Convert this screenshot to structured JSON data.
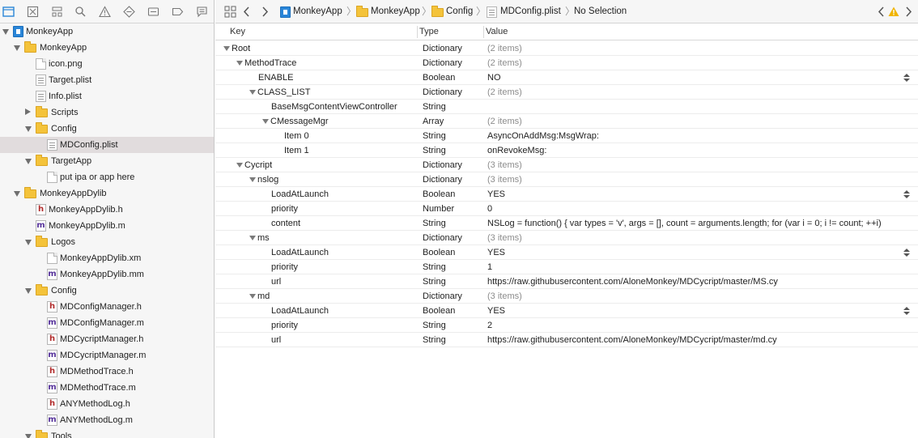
{
  "nav_toolbar": {
    "icons": [
      "project-navigator-icon",
      "source-control-icon",
      "symbol-navigator-icon",
      "find-icon",
      "issue-icon",
      "test-icon",
      "debug-icon",
      "breakpoint-icon",
      "report-icon"
    ]
  },
  "nav_tree": [
    {
      "label": "MonkeyApp",
      "kind": "project",
      "depth": 0,
      "state": "open"
    },
    {
      "label": "MonkeyApp",
      "kind": "folder",
      "depth": 1,
      "state": "open"
    },
    {
      "label": "icon.png",
      "kind": "file",
      "depth": 2
    },
    {
      "label": "Target.plist",
      "kind": "plist",
      "depth": 2
    },
    {
      "label": "Info.plist",
      "kind": "plist",
      "depth": 2
    },
    {
      "label": "Scripts",
      "kind": "folder",
      "depth": 2,
      "state": "closed"
    },
    {
      "label": "Config",
      "kind": "folder",
      "depth": 2,
      "state": "open"
    },
    {
      "label": "MDConfig.plist",
      "kind": "plist",
      "depth": 3,
      "selected": true
    },
    {
      "label": "TargetApp",
      "kind": "folder",
      "depth": 2,
      "state": "open"
    },
    {
      "label": "put ipa or app here",
      "kind": "file",
      "depth": 3
    },
    {
      "label": "MonkeyAppDylib",
      "kind": "folder",
      "depth": 1,
      "state": "open"
    },
    {
      "label": "MonkeyAppDylib.h",
      "kind": "h",
      "depth": 2
    },
    {
      "label": "MonkeyAppDylib.m",
      "kind": "m",
      "depth": 2
    },
    {
      "label": "Logos",
      "kind": "folder",
      "depth": 2,
      "state": "open"
    },
    {
      "label": "MonkeyAppDylib.xm",
      "kind": "file",
      "depth": 3
    },
    {
      "label": "MonkeyAppDylib.mm",
      "kind": "m",
      "depth": 3
    },
    {
      "label": "Config",
      "kind": "folder",
      "depth": 2,
      "state": "open"
    },
    {
      "label": "MDConfigManager.h",
      "kind": "h",
      "depth": 3
    },
    {
      "label": "MDConfigManager.m",
      "kind": "m",
      "depth": 3
    },
    {
      "label": "MDCycriptManager.h",
      "kind": "h",
      "depth": 3
    },
    {
      "label": "MDCycriptManager.m",
      "kind": "m",
      "depth": 3
    },
    {
      "label": "MDMethodTrace.h",
      "kind": "h",
      "depth": 3
    },
    {
      "label": "MDMethodTrace.m",
      "kind": "m",
      "depth": 3
    },
    {
      "label": "ANYMethodLog.h",
      "kind": "h",
      "depth": 3
    },
    {
      "label": "ANYMethodLog.m",
      "kind": "m",
      "depth": 3
    },
    {
      "label": "Tools",
      "kind": "folder",
      "depth": 2,
      "state": "open"
    }
  ],
  "jumpbar": {
    "crumbs": [
      "MonkeyApp",
      "MonkeyApp",
      "Config",
      "MDConfig.plist",
      "No Selection"
    ]
  },
  "plist": {
    "columns": {
      "key": "Key",
      "type": "Type",
      "value": "Value"
    },
    "rows": [
      {
        "key": "Root",
        "type": "Dictionary",
        "value": "(2 items)",
        "depth": 0,
        "disclosure": true,
        "gray": true
      },
      {
        "key": "MethodTrace",
        "type": "Dictionary",
        "value": "(2 items)",
        "depth": 1,
        "disclosure": true,
        "gray": true
      },
      {
        "key": "ENABLE",
        "type": "Boolean",
        "value": "NO",
        "depth": 2,
        "stepper": true
      },
      {
        "key": "CLASS_LIST",
        "type": "Dictionary",
        "value": "(2 items)",
        "depth": 2,
        "disclosure": true,
        "gray": true
      },
      {
        "key": "BaseMsgContentViewController",
        "type": "String",
        "value": "",
        "depth": 3
      },
      {
        "key": "CMessageMgr",
        "type": "Array",
        "value": "(2 items)",
        "depth": 3,
        "disclosure": true,
        "gray": true
      },
      {
        "key": "Item 0",
        "type": "String",
        "value": "AsyncOnAddMsg:MsgWrap:",
        "depth": 4
      },
      {
        "key": "Item 1",
        "type": "String",
        "value": "onRevokeMsg:",
        "depth": 4
      },
      {
        "key": "Cycript",
        "type": "Dictionary",
        "value": "(3 items)",
        "depth": 1,
        "disclosure": true,
        "gray": true
      },
      {
        "key": "nslog",
        "type": "Dictionary",
        "value": "(3 items)",
        "depth": 2,
        "disclosure": true,
        "gray": true
      },
      {
        "key": "LoadAtLaunch",
        "type": "Boolean",
        "value": "YES",
        "depth": 3,
        "stepper": true
      },
      {
        "key": "priority",
        "type": "Number",
        "value": "0",
        "depth": 3
      },
      {
        "key": "content",
        "type": "String",
        "value": "NSLog = function() { var types = 'v', args = [], count = arguments.length; for (var i = 0; i != count; ++i)",
        "depth": 3
      },
      {
        "key": "ms",
        "type": "Dictionary",
        "value": "(3 items)",
        "depth": 2,
        "disclosure": true,
        "gray": true
      },
      {
        "key": "LoadAtLaunch",
        "type": "Boolean",
        "value": "YES",
        "depth": 3,
        "stepper": true
      },
      {
        "key": "priority",
        "type": "String",
        "value": "1",
        "depth": 3
      },
      {
        "key": "url",
        "type": "String",
        "value": "https://raw.githubusercontent.com/AloneMonkey/MDCycript/master/MS.cy",
        "depth": 3
      },
      {
        "key": "md",
        "type": "Dictionary",
        "value": "(3 items)",
        "depth": 2,
        "disclosure": true,
        "gray": true
      },
      {
        "key": "LoadAtLaunch",
        "type": "Boolean",
        "value": "YES",
        "depth": 3,
        "stepper": true
      },
      {
        "key": "priority",
        "type": "String",
        "value": "2",
        "depth": 3
      },
      {
        "key": "url",
        "type": "String",
        "value": "https://raw.githubusercontent.com/AloneMonkey/MDCycript/master/md.cy",
        "depth": 3
      }
    ]
  },
  "colors": {
    "selection": "#e1dcdd",
    "folder": "#f4c33a",
    "warning": "#f0b400"
  }
}
